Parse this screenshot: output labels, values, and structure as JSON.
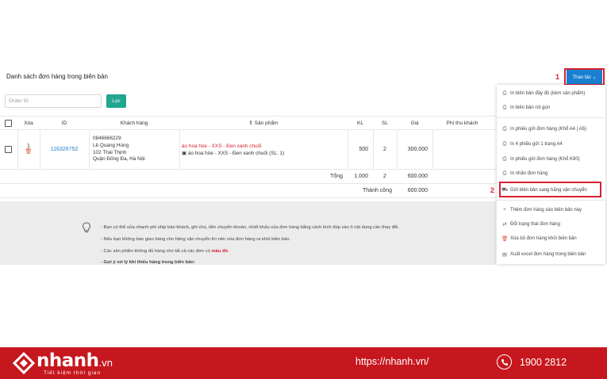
{
  "header": {
    "title": "Danh sách đơn hàng trong biên bản",
    "action_button": "Thao tác",
    "action_chevron": "⌄"
  },
  "filter": {
    "order_placeholder": "Order ID",
    "filter_button": "Lọc"
  },
  "markers": {
    "one": "1",
    "two": "2"
  },
  "table": {
    "columns": [
      "Xóa",
      "ID",
      "Khách hàng",
      "⇕ Sản phẩm",
      "KL",
      "SL",
      "Giá",
      "Phí thu khách"
    ],
    "row": {
      "index": "1",
      "id": "116326752",
      "customer": [
        "0846666229",
        "Lê Quang Hùng",
        "102 Thái Thịnh",
        "Quận Đống Đa, Hà Nội"
      ],
      "product_link": "áo hoa hòe - XXS - Đen xanh chuối",
      "product_detail": "▣ áo hoa hòe - XXS - Đen xanh chuối (SL: 1)",
      "kl": "500",
      "sl": "2",
      "price": "300.000"
    },
    "total": {
      "label": "Tổng",
      "kl": "1.000",
      "sl": "2",
      "price": "600.000"
    },
    "success": {
      "label": "Thành công",
      "price": "600.000"
    }
  },
  "notes": {
    "line1": "- Bạn có thể sửa nhanh phí ship báo khách, ghi chú, tiền chuyển khoản, chiết khấu của đơn hàng bằng cách kích đúp vào ô nội dung cần thay đổi.",
    "line2": "- Nếu bạn không bàn giao hàng cho hãng vận chuyển thì nên xóa đơn hàng ra khỏi biên bản.",
    "line3_before": "- Các sản phẩm không đủ hàng cho tất cả các đơn có ",
    "line3_red": "màu đỏ",
    "line3_after": ".",
    "line4": "- Gợi ý xử lý khi thiếu hàng trong biên bản:"
  },
  "dropdown": {
    "items": [
      "In biên bản đầy đủ (kèm sản phẩm)",
      "In biên bản rút gọn",
      "In phiếu gửi đơn hàng (Khổ A4 | A5)",
      "In 4 phiếu gửi 1 trang A4",
      "In phiếu gửi đơn hàng (Khổ K80)",
      "In nhãn đơn hàng",
      "Gửi biên bản sang hãng vận chuyển",
      "Thêm đơn hàng vào biên bản này",
      "Đổi trạng thái đơn hàng",
      "Xóa bỏ đơn hàng khỏi biên bản",
      "Xuất excel đơn hàng trong biên bản"
    ]
  },
  "footer": {
    "logo": "nhanh",
    "logo_tld": ".vn",
    "slogan": "Tiết kiệm thời gian",
    "website": "https://nhanh.vn/",
    "phone": "1900 2812"
  },
  "colors": {
    "brand_red": "#c7171e",
    "accent_blue": "#1a7fd0",
    "accent_green": "#21a690",
    "highlight": "#d8202f"
  }
}
